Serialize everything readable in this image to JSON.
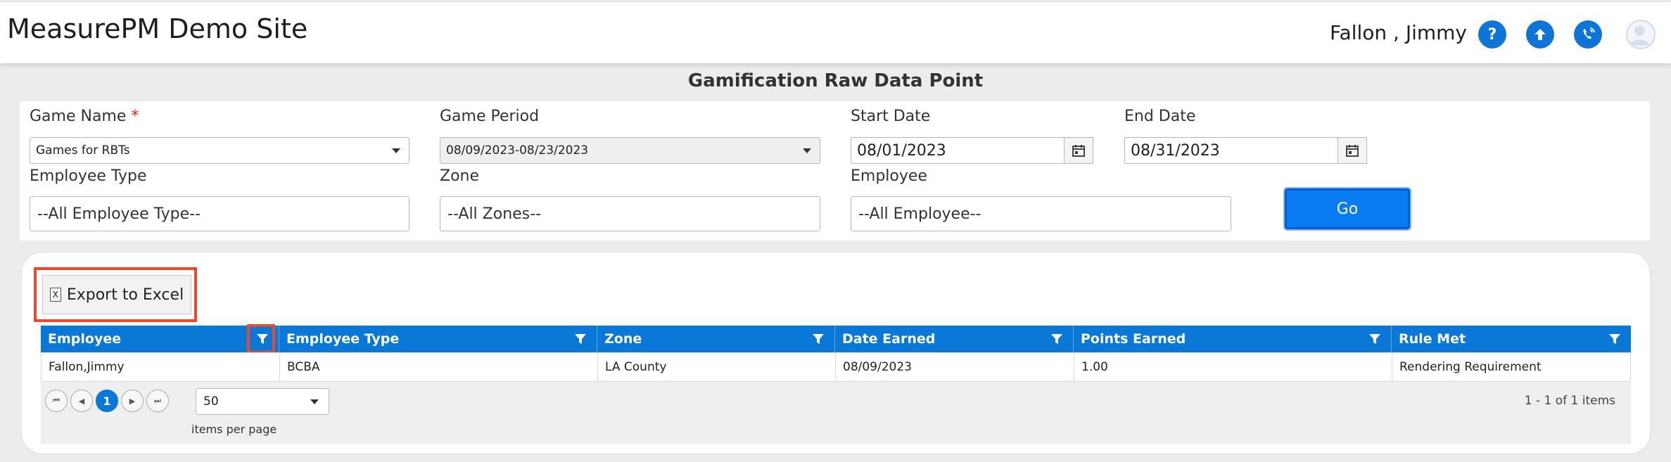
{
  "header": {
    "site_title": "MeasurePM Demo Site",
    "user_name": "Fallon , Jimmy",
    "icons": [
      "help-icon",
      "upload-icon",
      "phone-icon",
      "avatar"
    ],
    "help_glyph": "?",
    "accent_color": "#0f74d8"
  },
  "page": {
    "title": "Gamification Raw Data Point"
  },
  "filters": {
    "game_name": {
      "label": "Game Name",
      "required_mark": "*",
      "value": "Games for RBTs"
    },
    "game_period": {
      "label": "Game Period",
      "value": "08/09/2023-08/23/2023"
    },
    "start_date": {
      "label": "Start Date",
      "value": "08/01/2023"
    },
    "end_date": {
      "label": "End Date",
      "value": "08/31/2023"
    },
    "employee_type": {
      "label": "Employee Type",
      "value": "--All Employee Type--"
    },
    "zone": {
      "label": "Zone",
      "value": "--All Zones--"
    },
    "employee": {
      "label": "Employee",
      "value": "--All Employee--"
    },
    "go_label": "Go"
  },
  "grid": {
    "export_label": "Export to Excel",
    "export_icon_glyph": "X",
    "columns": [
      "Employee",
      "Employee Type",
      "Zone",
      "Date Earned",
      "Points Earned",
      "Rule Met"
    ],
    "rows": [
      [
        "Fallon,Jimmy",
        "BCBA",
        "LA County",
        "08/09/2023",
        "1.00",
        "Rendering Requirement"
      ]
    ],
    "header_color": "#0a78d7",
    "highlight_color": "#ea4a2e"
  },
  "pager": {
    "current_page": "1",
    "page_size": "50",
    "items_per_page_label": "items per page",
    "info": "1 - 1 of 1 items"
  }
}
